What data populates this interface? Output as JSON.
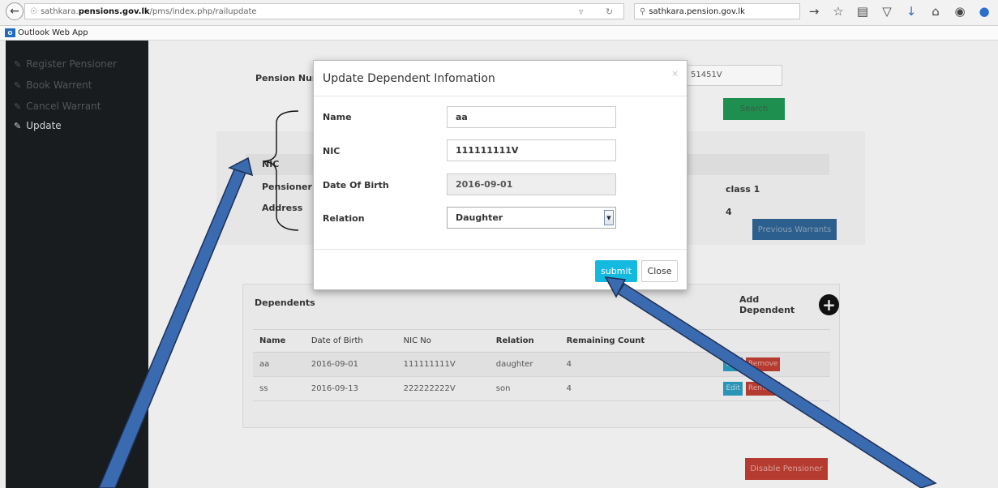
{
  "browser": {
    "url_prefix": "sathkara.",
    "url_domain": "pensions.gov.lk",
    "url_path": "/pms/index.php/railupdate",
    "search_text": "sathkara.pension.gov.lk",
    "bookmark_label": "Outlook Web App",
    "bookmark_icon_text": "O"
  },
  "sidebar": {
    "items": [
      {
        "label": "Register Pensioner"
      },
      {
        "label": "Book Warrent"
      },
      {
        "label": "Cancel Warrant"
      },
      {
        "label": "Update"
      }
    ]
  },
  "page": {
    "pension_number_label": "Pension Numbe",
    "pension_number_value": "51451V",
    "search_button": "Search",
    "nic_label": "NIC",
    "pensioner_name_label": "Pensioner Na",
    "address_label": "Address",
    "class_value": "class 1",
    "count_value": "4",
    "previous_warrants_button": "Previous Warrants",
    "disable_pensioner_button": "Disable Pensioner"
  },
  "dependents": {
    "title": "Dependents",
    "add_label": "Add Dependent",
    "columns": [
      "Name",
      "Date of Birth",
      "NIC No",
      "Relation",
      "Remaining Count"
    ],
    "rows": [
      {
        "name": "aa",
        "dob": "2016-09-01",
        "nic": "111111111V",
        "relation": "daughter",
        "remaining": "4"
      },
      {
        "name": "ss",
        "dob": "2016-09-13",
        "nic": "222222222V",
        "relation": "son",
        "remaining": "4"
      }
    ],
    "edit_label": "Edit",
    "remove_label": "Remove"
  },
  "modal": {
    "title": "Update Dependent Infomation",
    "close_x": "×",
    "fields": {
      "name_label": "Name",
      "name_value": "aa",
      "nic_label": "NIC",
      "nic_value": "111111111V",
      "dob_label": "Date Of Birth",
      "dob_value": "2016-09-01",
      "relation_label": "Relation",
      "relation_value": "Daughter"
    },
    "submit_label": "submit",
    "close_label": "Close"
  },
  "colors": {
    "submit": "#14b9e0",
    "arrow": "#3a6bb0",
    "sidebar": "#181c1e"
  }
}
